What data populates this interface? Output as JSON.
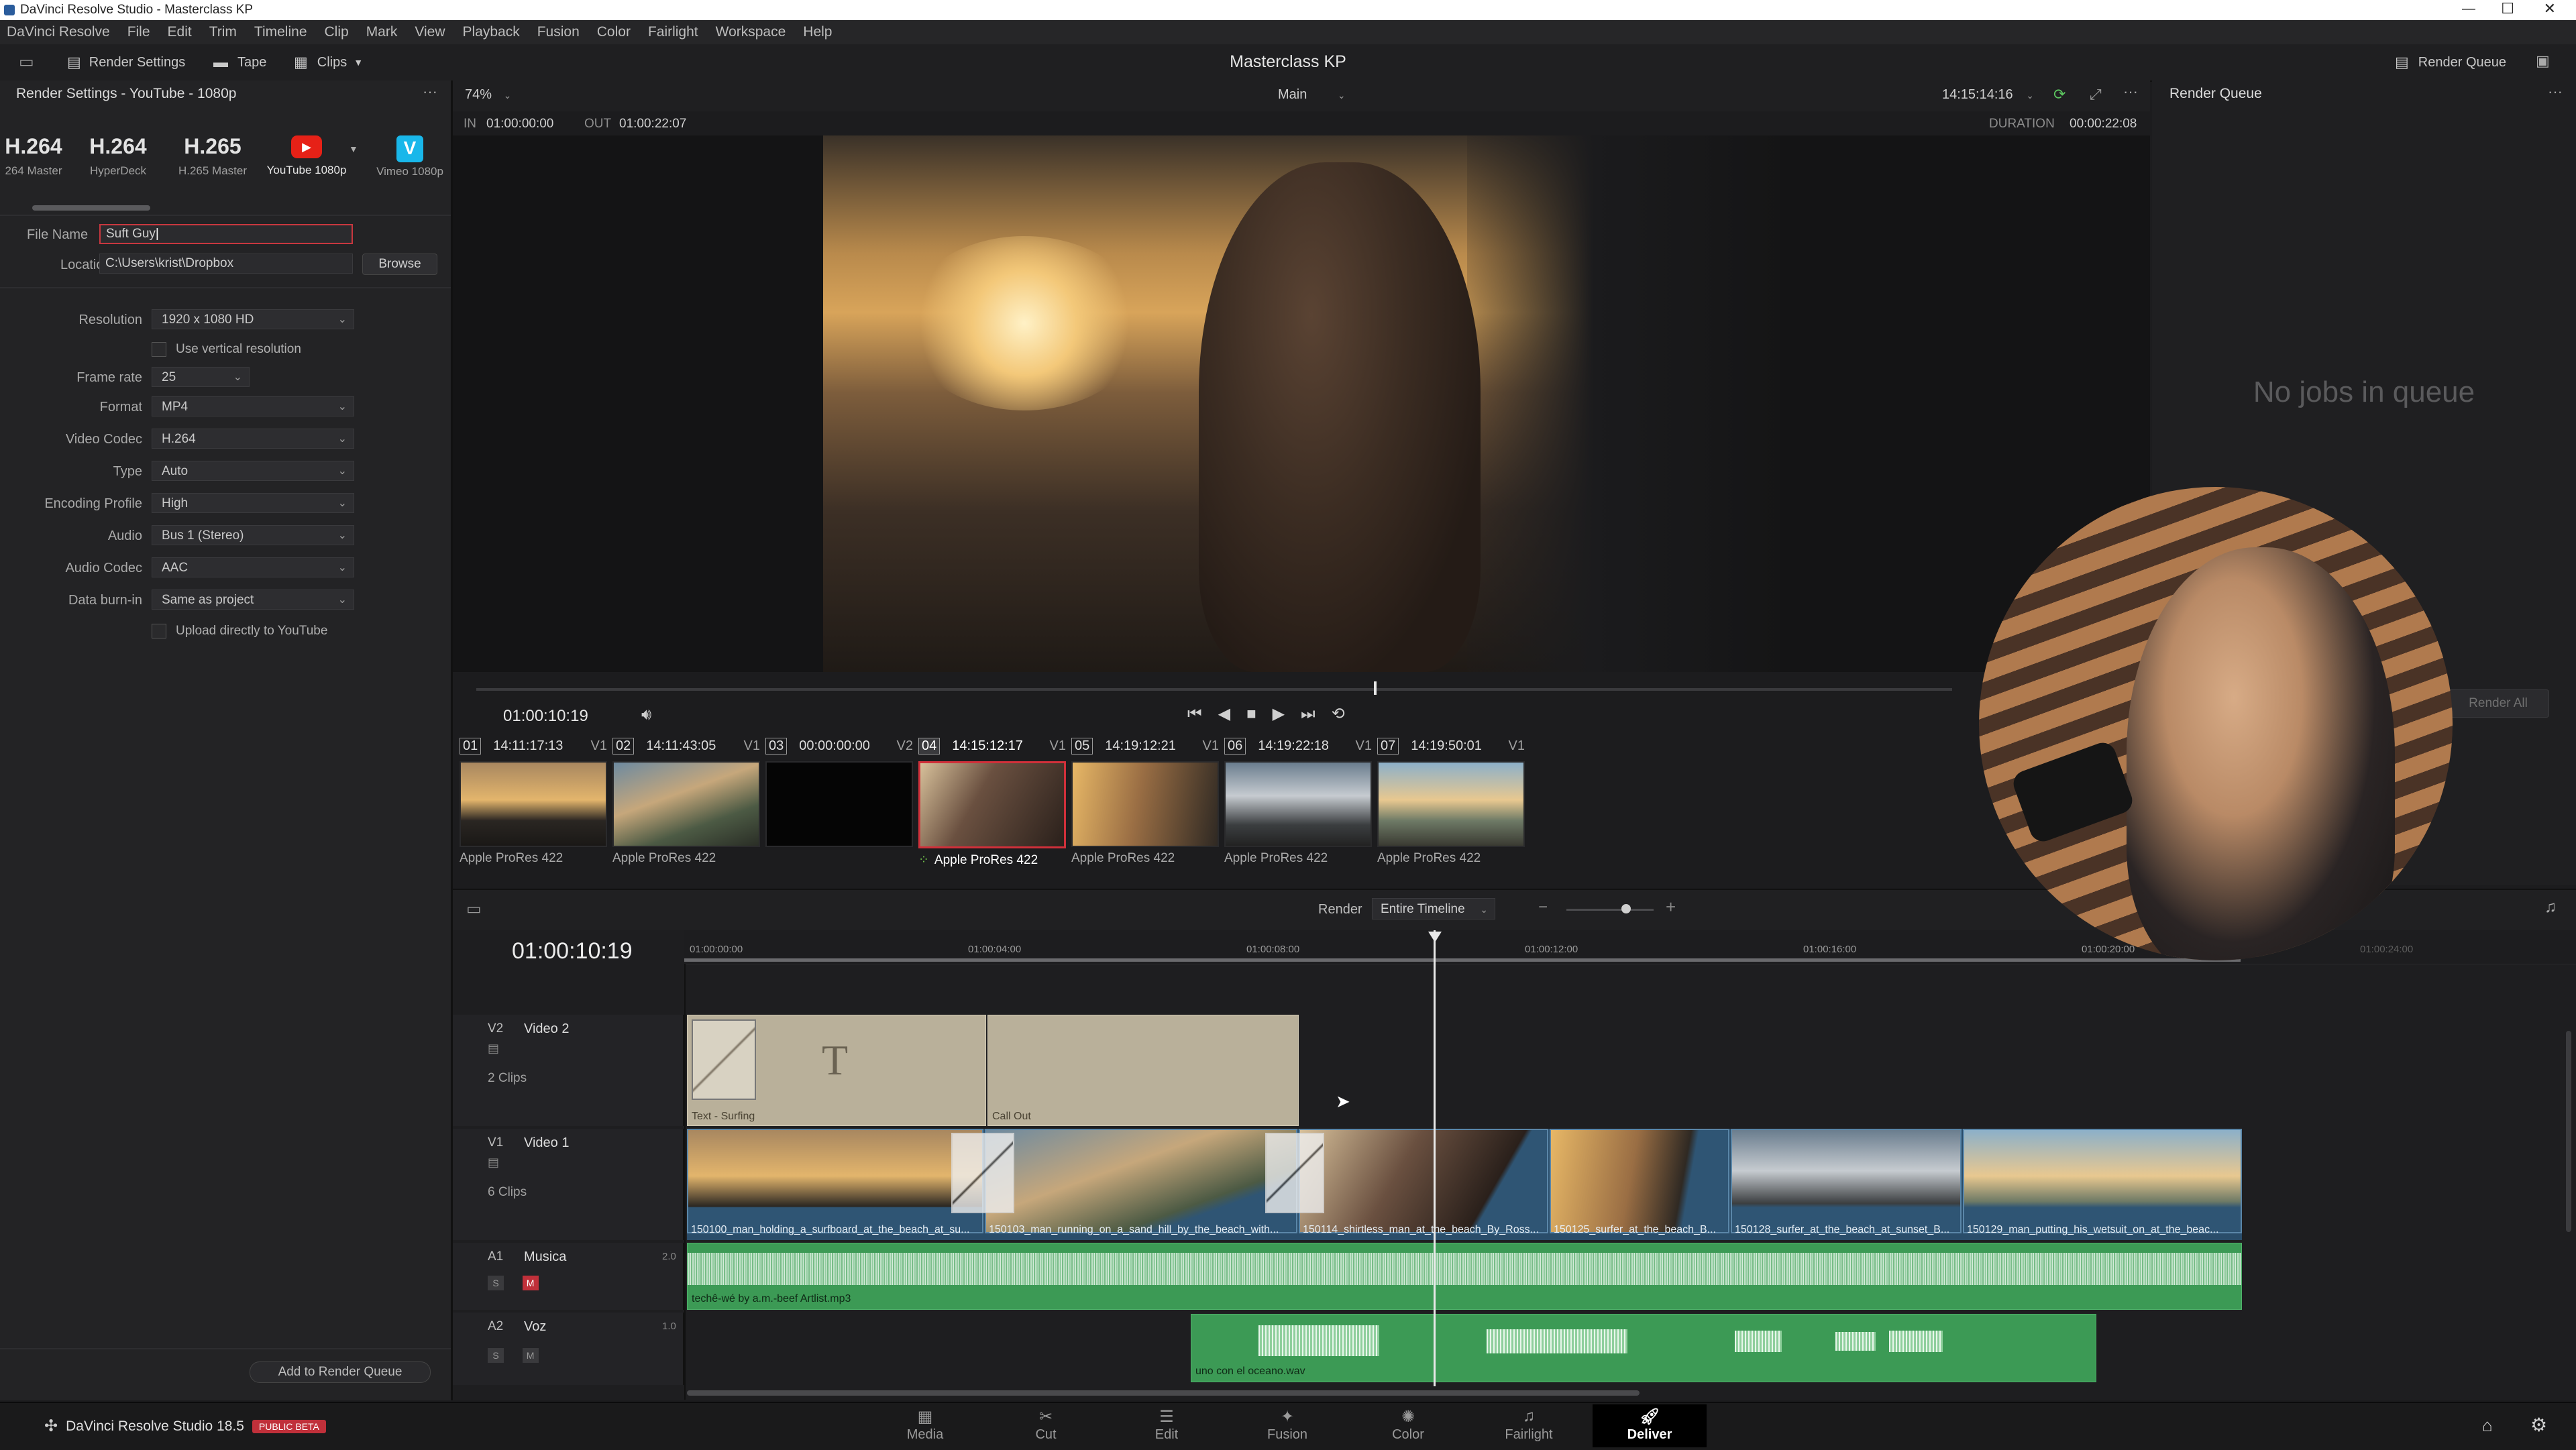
{
  "window": {
    "title": "DaVinci Resolve Studio - Masterclass KP"
  },
  "menu": [
    "DaVinci Resolve",
    "File",
    "Edit",
    "Trim",
    "Timeline",
    "Clip",
    "Mark",
    "View",
    "Playback",
    "Fusion",
    "Color",
    "Fairlight",
    "Workspace",
    "Help"
  ],
  "toolbar": {
    "render_settings": "Render Settings",
    "tape": "Tape",
    "clips": "Clips",
    "project_title": "Masterclass KP",
    "render_queue": "Render Queue"
  },
  "render_settings": {
    "header": "Render Settings - YouTube - 1080p",
    "presets": [
      {
        "big": "H.264",
        "small": "264 Master"
      },
      {
        "big": "H.264",
        "small": "HyperDeck"
      },
      {
        "big": "H.265",
        "small": "H.265 Master"
      },
      {
        "big": "",
        "small": "YouTube 1080p"
      },
      {
        "big": "",
        "small": "Vimeo 1080p"
      }
    ],
    "file_name_label": "File Name",
    "file_name_value": "Suft Guy",
    "location_label": "Location",
    "location_value": "C:\\Users\\krist\\Dropbox",
    "browse": "Browse",
    "resolution_label": "Resolution",
    "resolution_value": "1920 x 1080 HD",
    "vertical_label": "Use vertical resolution",
    "frame_rate_label": "Frame rate",
    "frame_rate_value": "25",
    "format_label": "Format",
    "format_value": "MP4",
    "video_codec_label": "Video Codec",
    "video_codec_value": "H.264",
    "type_label": "Type",
    "type_value": "Auto",
    "encoding_label": "Encoding Profile",
    "encoding_value": "High",
    "audio_label": "Audio",
    "audio_value": "Bus 1 (Stereo)",
    "audio_codec_label": "Audio Codec",
    "audio_codec_value": "AAC",
    "burnin_label": "Data burn-in",
    "burnin_value": "Same as project",
    "upload_label": "Upload directly to YouTube",
    "add_queue": "Add to Render Queue"
  },
  "viewer": {
    "zoom": "74%",
    "main": "Main",
    "timecode_top": "14:15:14:16",
    "in_label": "IN",
    "in_value": "01:00:00:00",
    "out_label": "OUT",
    "out_value": "01:00:22:07",
    "duration_label": "DURATION",
    "duration_value": "00:00:22:08",
    "playhead_tc": "01:00:10:19"
  },
  "render_queue": {
    "title": "Render Queue",
    "empty": "No jobs in queue",
    "render_all": "Render All"
  },
  "clips": [
    {
      "num": "01",
      "tc": "14:11:17:13",
      "track": "V1",
      "codec": "Apple ProRes 422"
    },
    {
      "num": "02",
      "tc": "14:11:43:05",
      "track": "V1",
      "codec": "Apple ProRes 422"
    },
    {
      "num": "03",
      "tc": "00:00:00:00",
      "track": "V2",
      "codec": ""
    },
    {
      "num": "04",
      "tc": "14:15:12:17",
      "track": "V1",
      "codec": "Apple ProRes 422"
    },
    {
      "num": "05",
      "tc": "14:19:12:21",
      "track": "V1",
      "codec": "Apple ProRes 422"
    },
    {
      "num": "06",
      "tc": "14:19:22:18",
      "track": "V1",
      "codec": "Apple ProRes 422"
    },
    {
      "num": "07",
      "tc": "14:19:50:01",
      "track": "V1",
      "codec": "Apple ProRes 422"
    }
  ],
  "timeline": {
    "render_label": "Render",
    "render_scope": "Entire Timeline",
    "timecode": "01:00:10:19",
    "ruler": [
      "01:00:00:00",
      "01:00:04:00",
      "01:00:08:00",
      "01:00:12:00",
      "01:00:16:00",
      "01:00:20:00",
      "01:00:24:00"
    ],
    "tracks": {
      "v2": {
        "id": "V2",
        "name": "Video 2",
        "count": "2 Clips",
        "clips": [
          "Text - Surfing",
          "Call Out"
        ]
      },
      "v1": {
        "id": "V1",
        "name": "Video 1",
        "count": "6 Clips",
        "clips": [
          "150100_man_holding_a_surfboard_at_the_beach_at_su...",
          "150103_man_running_on_a_sand_hill_by_the_beach_with...",
          "150114_shirtless_man_at_the_beach_By_Ross...",
          "150125_surfer_at_the_beach_B...",
          "150128_surfer_at_the_beach_at_sunset_B...",
          "150129_man_putting_his_wetsuit_on_at_the_beac..."
        ]
      },
      "a1": {
        "id": "A1",
        "name": "Musica",
        "level": "2.0",
        "clip": "techê-wé by a.m.-beef Artlist.mp3"
      },
      "a2": {
        "id": "A2",
        "name": "Voz",
        "level": "1.0",
        "clip": "uno con el oceano.wav"
      }
    },
    "solo": "S",
    "mute": "M"
  },
  "bottom": {
    "app": "DaVinci Resolve Studio 18.5",
    "badge": "PUBLIC BETA",
    "pages": [
      "Media",
      "Cut",
      "Edit",
      "Fusion",
      "Color",
      "Fairlight",
      "Deliver"
    ]
  },
  "colors": {
    "accent_red": "#d0303a",
    "audio_green": "#3c9a55",
    "text_clip": "#b9b09a",
    "deliver_active": "#cfcfcf"
  }
}
